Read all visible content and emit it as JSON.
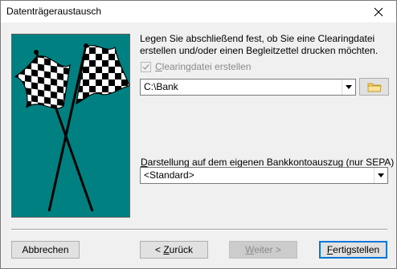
{
  "window": {
    "title": "Datenträgeraustausch"
  },
  "description": "Legen Sie abschließend fest, ob Sie eine Clearingdatei erstellen und/oder einen Begleitzettel drucken möchten.",
  "clearing_checkbox": {
    "label_accel": "C",
    "label_rest": "learingdatei erstellen",
    "checked": true,
    "enabled": false
  },
  "path_combo": {
    "value": "C:\\Bank"
  },
  "statement_label": {
    "accel": "D",
    "rest": "arstellung auf dem eigenen Bankkontoauszug (nur SEPA)"
  },
  "statement_combo": {
    "value": "<Standard>"
  },
  "buttons": {
    "cancel": "Abbrechen",
    "back_prefix": "< ",
    "back_accel": "Z",
    "back_rest": "urück",
    "next_accel": "W",
    "next_rest": "eiter >",
    "finish_accel": "F",
    "finish_rest": "ertigstellen"
  },
  "icons": {
    "close": "close-icon",
    "folder": "folder-icon",
    "dropdown": "chevron-down-icon",
    "check": "checkmark-icon",
    "image": "checkered-flags"
  },
  "colors": {
    "flag_background": "#008080",
    "focus": "#0078d7",
    "folder": "#f2d26b"
  }
}
